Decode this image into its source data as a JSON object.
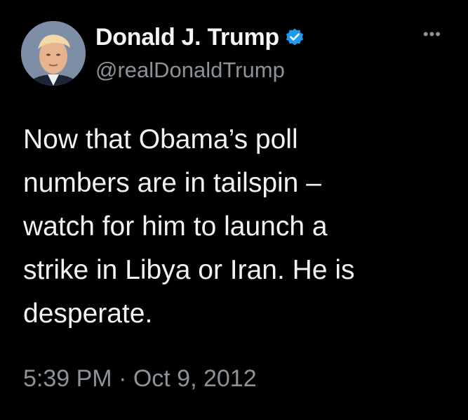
{
  "author": {
    "display_name": "Donald J. Trump",
    "handle": "@realDonaldTrump",
    "verified": true,
    "verified_color": "#1d9bf0",
    "avatar_icon": "profile-photo"
  },
  "menu_icon": "more-options-icon",
  "tweet": {
    "lines": [
      "Now that Obama’s poll",
      "numbers are in tailspin –",
      "watch for him to launch a",
      "strike in Libya or Iran.  He is",
      "desperate."
    ],
    "timestamp": "5:39 PM · Oct 9, 2012"
  },
  "colors": {
    "background": "#000000",
    "primary_text": "#f2f2f2",
    "secondary_text": "#8b9298"
  }
}
